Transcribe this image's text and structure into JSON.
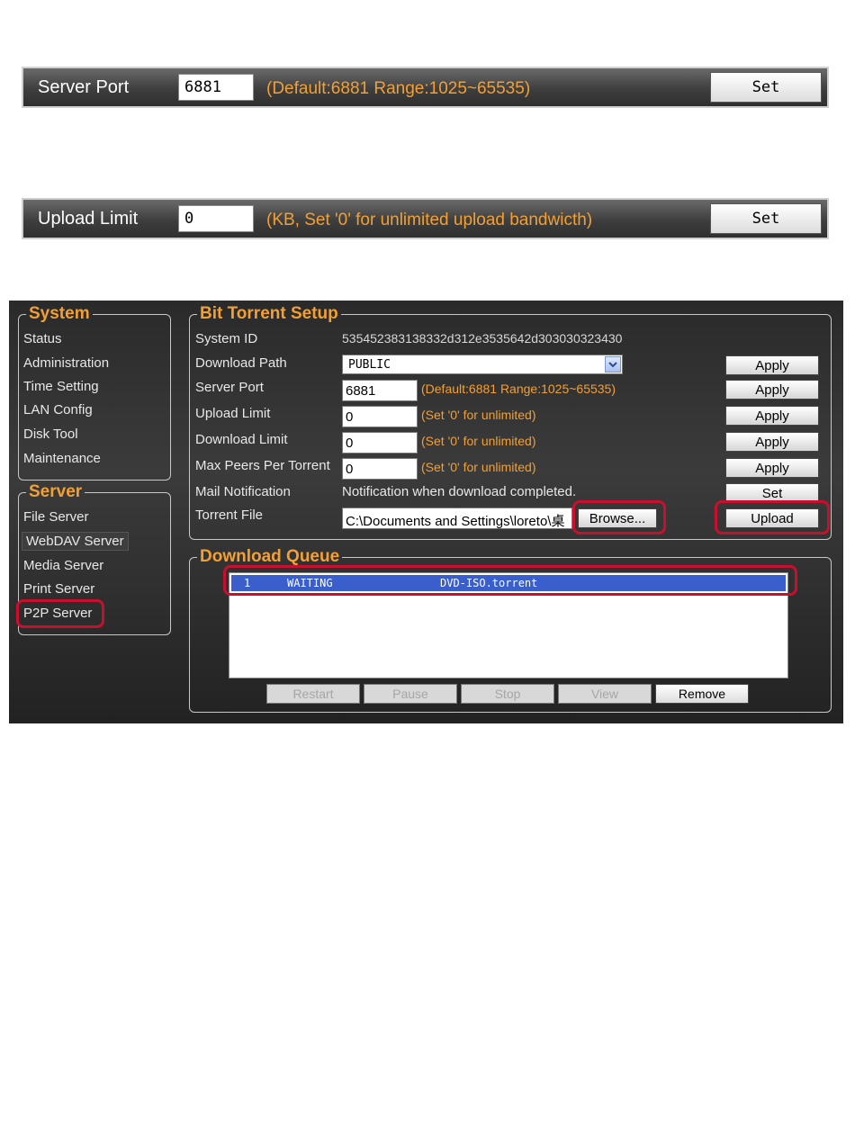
{
  "strip_port": {
    "label": "Server Port",
    "value": "6881",
    "hint": "(Default:6881  Range:1025~65535)",
    "button": "Set"
  },
  "strip_upload": {
    "label": "Upload Limit",
    "value": "0",
    "hint": "(KB, Set '0' for unlimited upload bandwicth)",
    "button": "Set"
  },
  "system_group": {
    "title": "System",
    "items": [
      "Status",
      "Administration",
      "Time Setting",
      "LAN Config",
      "Disk Tool",
      "Maintenance"
    ]
  },
  "server_group": {
    "title": "Server",
    "items": [
      "File Server",
      "WebDAV Server",
      "Media Server",
      "Print Server",
      "P2P Server"
    ]
  },
  "bt": {
    "title": "Bit Torrent Setup",
    "system_id": {
      "label": "System ID",
      "value": "535452383138332d312e3535642d303030323430"
    },
    "download_path": {
      "label": "Download Path",
      "value": "PUBLIC"
    },
    "server_port": {
      "label": "Server Port",
      "value": "6881",
      "hint": "(Default:6881 Range:1025~65535)"
    },
    "upload_limit": {
      "label": "Upload Limit",
      "value": "0",
      "hint": "(Set '0' for unlimited)"
    },
    "download_limit": {
      "label": "Download Limit",
      "value": "0",
      "hint": "(Set '0' for unlimited)"
    },
    "max_peers": {
      "label": "Max Peers Per Torrent",
      "value": "0",
      "hint": "(Set '0' for unlimited)"
    },
    "mail": {
      "label": "Mail Notification",
      "text": "Notification when download completed."
    },
    "torrent": {
      "label": "Torrent File",
      "value": "C:\\Documents and Settings\\loreto\\桌"
    },
    "apply_label": "Apply",
    "set_label": "Set",
    "browse_label": "Browse...",
    "upload_label": "Upload"
  },
  "queue": {
    "title": "Download Queue",
    "rows": [
      {
        "num": "1",
        "status": "WAITING",
        "file": "DVD-ISO.torrent"
      }
    ],
    "buttons": {
      "restart": "Restart",
      "pause": "Pause",
      "stop": "Stop",
      "view": "View",
      "remove": "Remove"
    }
  },
  "colors": {
    "accent": "#f2a035",
    "highlight": "#c8102e",
    "selection": "#3a5fcd"
  }
}
